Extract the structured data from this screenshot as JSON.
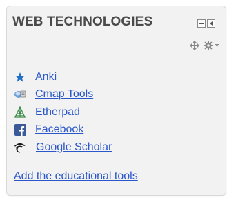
{
  "block": {
    "title": "WEB TECHNOLOGIES",
    "tools": [
      {
        "label": "Anki",
        "icon": "star-icon"
      },
      {
        "label": "Cmap Tools",
        "icon": "cmap-tools-icon"
      },
      {
        "label": "Etherpad",
        "icon": "etherpad-icon"
      },
      {
        "label": "Facebook",
        "icon": "facebook-icon"
      },
      {
        "label": "Google Scholar",
        "icon": "google-scholar-icon"
      }
    ],
    "add_link": "Add the educational tools"
  },
  "colors": {
    "link": "#2a57c9",
    "title": "#4a4a4a",
    "block_bg": "#f2f2f2",
    "facebook": "#3b5998"
  }
}
